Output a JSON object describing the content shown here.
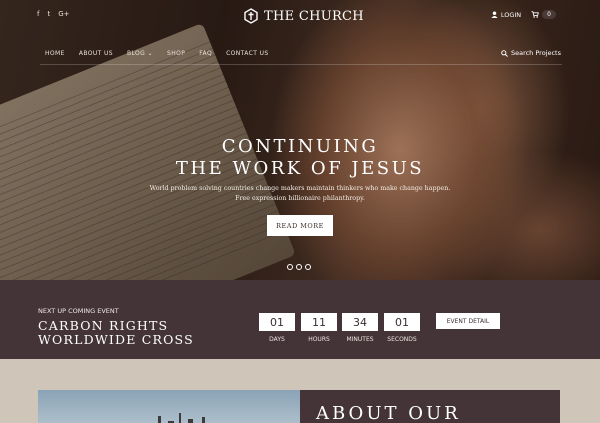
{
  "header": {
    "social": [
      "f",
      "t",
      "G+"
    ],
    "logo_text": "THE CHURCH",
    "login_label": "LOGIN",
    "cart_count": "0"
  },
  "nav": {
    "items": [
      "HOME",
      "ABOUT US",
      "BLOG",
      "SHOP",
      "FAQ",
      "CONTACT US"
    ],
    "search_label": "Search Projects"
  },
  "hero": {
    "title_line1": "CONTINUING",
    "title_line2": "THE WORK OF JESUS",
    "subtitle_line1": "World problem solving countries change makers maintain thinkers who make change happen.",
    "subtitle_line2": "Free expression billionaire philanthropy.",
    "button_label": "READ MORE"
  },
  "event": {
    "label": "NEXT UP COMING EVENT",
    "title_line1": "CARBON RIGHTS",
    "title_line2": "WORLDWIDE CROSS",
    "countdown": [
      {
        "value": "01",
        "label": "DAYS"
      },
      {
        "value": "11",
        "label": "HOURS"
      },
      {
        "value": "34",
        "label": "MINUTES"
      },
      {
        "value": "01",
        "label": "SECONDS"
      }
    ],
    "button_label": "EVENT DETAIL"
  },
  "about": {
    "title": "ABOUT OUR"
  },
  "colors": {
    "event_bg": "#443438",
    "page_bg": "#cfc6b9"
  }
}
